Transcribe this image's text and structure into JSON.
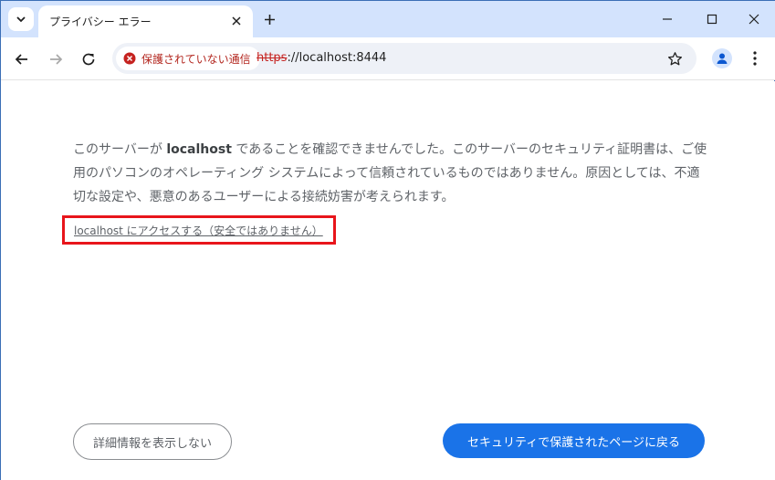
{
  "tab": {
    "title": "プライバシー エラー"
  },
  "omnibox": {
    "security_label": "保護されていない通信",
    "url_scheme": "https",
    "url_rest": "://localhost:8444"
  },
  "content": {
    "explanation_prefix": "このサーバーが ",
    "explanation_host": "localhost",
    "explanation_suffix": " であることを確認できませんでした。このサーバーのセキュリティ証明書は、ご使用のパソコンのオペレーティング システムによって信頼されているものではありません。原因としては、不適切な設定や、悪意のあるユーザーによる接続妨害が考えられます。",
    "proceed_link": "localhost にアクセスする（安全ではありません）",
    "details_button": "詳細情報を表示しない",
    "back_button": "セキュリティで保護されたページに戻る"
  },
  "colors": {
    "tabstrip": "#d3e3fd",
    "warning_red": "#c5221f",
    "primary_blue": "#1a73e8",
    "highlight_box": "#e8151b"
  },
  "icons": [
    "chevron-down-icon",
    "close-icon",
    "plus-icon",
    "minimize-icon",
    "maximize-icon",
    "window-close-icon",
    "back-arrow-icon",
    "forward-arrow-icon",
    "reload-icon",
    "error-icon",
    "star-icon",
    "profile-icon",
    "kebab-menu-icon"
  ]
}
